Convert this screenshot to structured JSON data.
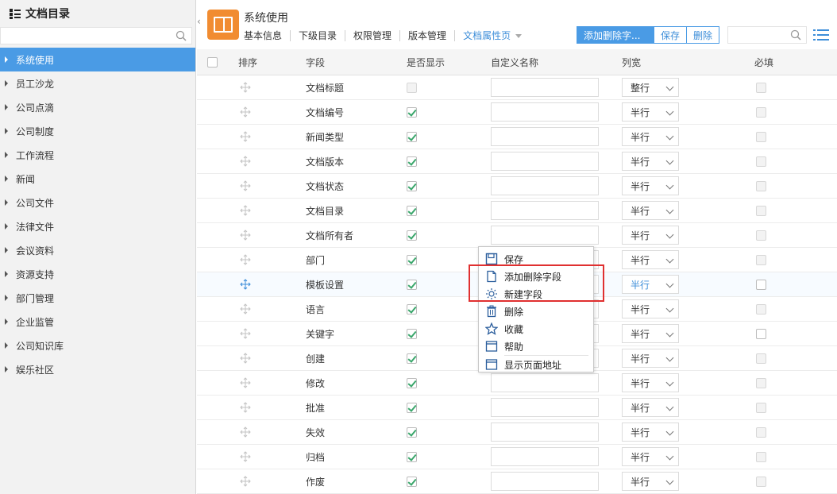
{
  "sidebar": {
    "title": "文档目录",
    "search_placeholder": "",
    "items": [
      {
        "label": "系统使用",
        "active": true
      },
      {
        "label": "员工沙龙"
      },
      {
        "label": "公司点滴"
      },
      {
        "label": "公司制度"
      },
      {
        "label": "工作流程"
      },
      {
        "label": "新闻"
      },
      {
        "label": "公司文件"
      },
      {
        "label": "法律文件"
      },
      {
        "label": "会议资料"
      },
      {
        "label": "资源支持"
      },
      {
        "label": "部门管理"
      },
      {
        "label": "企业监管"
      },
      {
        "label": "公司知识库"
      },
      {
        "label": "娱乐社区"
      }
    ]
  },
  "header": {
    "title": "系统使用",
    "tabs": [
      "基本信息",
      "下级目录",
      "权限管理",
      "版本管理",
      "文档属性页"
    ],
    "active_tab": 4
  },
  "toolbar": {
    "add_delete_label": "添加删除字...",
    "save_label": "保存",
    "delete_label": "删除",
    "search_placeholder": ""
  },
  "table": {
    "columns": {
      "sort": "排序",
      "field": "字段",
      "show": "是否显示",
      "custom_name": "自定义名称",
      "width": "列宽",
      "required": "必填"
    },
    "rows": [
      {
        "field": "文档标题",
        "show": false,
        "show_disabled": true,
        "width": "整行",
        "req_disabled": true
      },
      {
        "field": "文档编号",
        "show": true,
        "show_disabled": false,
        "width": "半行",
        "req_disabled": true
      },
      {
        "field": "新闻类型",
        "show": true,
        "show_disabled": false,
        "width": "半行",
        "req_disabled": true
      },
      {
        "field": "文档版本",
        "show": true,
        "show_disabled": false,
        "width": "半行",
        "req_disabled": true
      },
      {
        "field": "文档状态",
        "show": true,
        "show_disabled": false,
        "width": "半行",
        "req_disabled": true
      },
      {
        "field": "文档目录",
        "show": true,
        "show_disabled": false,
        "width": "半行",
        "req_disabled": true
      },
      {
        "field": "文档所有者",
        "show": true,
        "show_disabled": false,
        "width": "半行",
        "req_disabled": true
      },
      {
        "field": "部门",
        "show": true,
        "show_disabled": false,
        "width": "半行",
        "req_disabled": true
      },
      {
        "field": "模板设置",
        "show": true,
        "show_disabled": false,
        "width": "半行",
        "req_disabled": false,
        "hover": true
      },
      {
        "field": "语言",
        "show": true,
        "show_disabled": false,
        "width": "半行",
        "req_disabled": true
      },
      {
        "field": "关键字",
        "show": true,
        "show_disabled": false,
        "width": "半行",
        "req_disabled": false
      },
      {
        "field": "创建",
        "show": true,
        "show_disabled": false,
        "width": "半行",
        "req_disabled": true
      },
      {
        "field": "修改",
        "show": true,
        "show_disabled": false,
        "width": "半行",
        "req_disabled": true
      },
      {
        "field": "批准",
        "show": true,
        "show_disabled": false,
        "width": "半行",
        "req_disabled": true
      },
      {
        "field": "失效",
        "show": true,
        "show_disabled": false,
        "width": "半行",
        "req_disabled": true
      },
      {
        "field": "归档",
        "show": true,
        "show_disabled": false,
        "width": "半行",
        "req_disabled": true
      },
      {
        "field": "作废",
        "show": true,
        "show_disabled": false,
        "width": "半行",
        "req_disabled": true
      }
    ]
  },
  "context_menu": {
    "items": [
      {
        "label": "保存",
        "icon": "save-icon"
      },
      {
        "label": "添加删除字段",
        "icon": "document-icon"
      },
      {
        "label": "新建字段",
        "icon": "sun-icon"
      },
      {
        "label": "删除",
        "icon": "trash-icon"
      },
      {
        "label": "收藏",
        "icon": "star-icon"
      },
      {
        "label": "帮助",
        "icon": "window-icon"
      },
      {
        "label": "显示页面地址",
        "icon": "window-icon"
      }
    ]
  },
  "colors": {
    "accent": "#4a9be5",
    "brand_orange": "#f18c31",
    "highlight": "#e03030"
  }
}
